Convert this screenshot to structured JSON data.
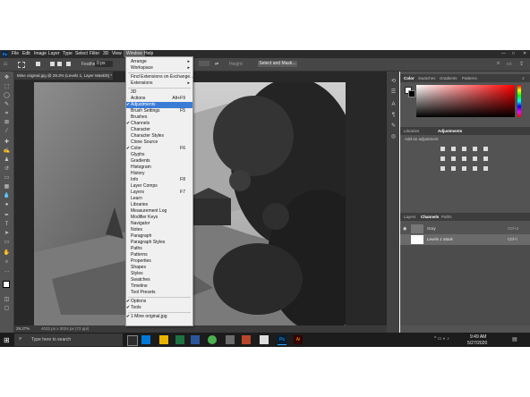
{
  "menubar": {
    "items": [
      "File",
      "Edit",
      "Image",
      "Layer",
      "Type",
      "Select",
      "Filter",
      "3D",
      "View",
      "Window",
      "Help"
    ]
  },
  "options_bar": {
    "feather_label": "Feather:",
    "feather_value": "0 px",
    "height_label": "Height:",
    "select_mask_label": "Select and Mask..."
  },
  "document": {
    "tab_title": "Mine original.jpg @ 29.3% (Levels 1, Layer Mask/8) *",
    "zoom": "29.27%",
    "doc_info": "4032 px x 3024 px (72 ppi)"
  },
  "window_menu": {
    "items": [
      {
        "label": "Arrange",
        "submenu": true
      },
      {
        "label": "Workspace",
        "submenu": true
      },
      {
        "sep": true
      },
      {
        "label": "Find Extensions on Exchange..."
      },
      {
        "label": "Extensions",
        "submenu": true
      },
      {
        "sep": true
      },
      {
        "label": "3D"
      },
      {
        "label": "Actions",
        "shortcut": "Alt+F9"
      },
      {
        "label": "Adjustments",
        "checked": true,
        "highlight": true
      },
      {
        "label": "Brush Settings",
        "shortcut": "F5"
      },
      {
        "label": "Brushes"
      },
      {
        "label": "Channels",
        "checked": true
      },
      {
        "label": "Character"
      },
      {
        "label": "Character Styles"
      },
      {
        "label": "Clone Source"
      },
      {
        "label": "Color",
        "checked": true,
        "shortcut": "F6"
      },
      {
        "label": "Glyphs"
      },
      {
        "label": "Gradients"
      },
      {
        "label": "Histogram"
      },
      {
        "label": "History"
      },
      {
        "label": "Info",
        "shortcut": "F8"
      },
      {
        "label": "Layer Comps"
      },
      {
        "label": "Layers",
        "shortcut": "F7"
      },
      {
        "label": "Learn"
      },
      {
        "label": "Libraries"
      },
      {
        "label": "Measurement Log"
      },
      {
        "label": "Modifier Keys"
      },
      {
        "label": "Navigator"
      },
      {
        "label": "Notes"
      },
      {
        "label": "Paragraph"
      },
      {
        "label": "Paragraph Styles"
      },
      {
        "label": "Paths"
      },
      {
        "label": "Patterns"
      },
      {
        "label": "Properties"
      },
      {
        "label": "Shapes"
      },
      {
        "label": "Styles"
      },
      {
        "label": "Swatches"
      },
      {
        "label": "Timeline"
      },
      {
        "label": "Tool Presets"
      },
      {
        "sep": true
      },
      {
        "label": "Options",
        "checked": true
      },
      {
        "label": "Tools",
        "checked": true
      },
      {
        "sep": true
      },
      {
        "label": "1 Mine original.jpg",
        "checked": true
      }
    ]
  },
  "panels": {
    "color_tabs": [
      "Color",
      "Swatches",
      "Gradients",
      "Patterns"
    ],
    "adj_tabs": [
      "Libraries",
      "Adjustments"
    ],
    "adj_title": "Add an adjustment",
    "layers_tabs": [
      "Layers",
      "Channels",
      "Paths"
    ],
    "channels": [
      {
        "name": "Gray",
        "shortcut": "Ctrl+2"
      },
      {
        "name": "Levels 1 Mask",
        "shortcut": "Ctrl+\\"
      }
    ]
  },
  "taskbar": {
    "search_placeholder": "Type here to search",
    "time": "9:49 AM",
    "date": "5/27/2020"
  },
  "colors": {
    "menu_highlight": "#3a7bd5",
    "panel_bg": "#535353",
    "taskbar_bg": "#1c1c1c"
  }
}
